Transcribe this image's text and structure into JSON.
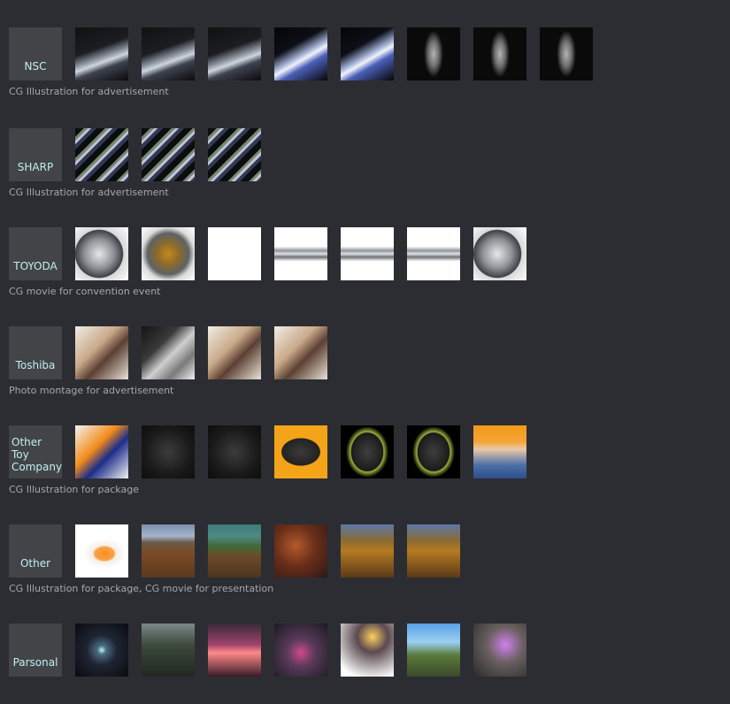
{
  "sections": [
    {
      "label_lines": [
        "NSC"
      ],
      "caption": "CG Illustration for advertisement",
      "thumbs": [
        "t-ship",
        "t-ship",
        "t-ship",
        "t-shipblue",
        "t-shipblue",
        "t-human",
        "t-human",
        "t-human"
      ]
    },
    {
      "label_lines": [
        "SHARP"
      ],
      "caption": "CG Illustration for advertisement",
      "thumbs": [
        "t-sharp",
        "t-sharp",
        "t-sharp"
      ]
    },
    {
      "label_lines": [
        "TOYODA"
      ],
      "caption": "CG movie for convention event",
      "thumbs": [
        "t-mech",
        "t-mechgold",
        "t-white",
        "t-pipe",
        "t-pipe",
        "t-pipe",
        "t-mech"
      ]
    },
    {
      "label_lines": [
        "Toshiba"
      ],
      "caption": "Photo montage for advertisement",
      "thumbs": [
        "t-photo",
        "t-laptop",
        "t-photo",
        "t-photo"
      ]
    },
    {
      "label_lines": [
        "Other",
        "Toy",
        "Company"
      ],
      "caption": "CG Illustration for package",
      "thumbs": [
        "t-box",
        "t-ball",
        "t-ball",
        "t-ballorg",
        "t-ballgrn",
        "t-ballgrn",
        "t-kid"
      ]
    },
    {
      "label_lines": [
        "Other"
      ],
      "caption": "CG Illustration for package, CG movie for presentation",
      "thumbs": [
        "t-egg",
        "t-land",
        "t-landg",
        "t-autumn",
        "t-forest",
        "t-forest"
      ]
    },
    {
      "label_lines": [
        "Parsonal"
      ],
      "caption": "",
      "thumbs": [
        "t-space",
        "t-scene",
        "t-sunset",
        "t-magic",
        "t-robot",
        "t-bright",
        "t-mist"
      ]
    }
  ],
  "colors": {
    "background": "#2c2d32",
    "label_box": "#434448",
    "label_text": "#bff0f0",
    "caption_text": "#a6a7ab"
  }
}
